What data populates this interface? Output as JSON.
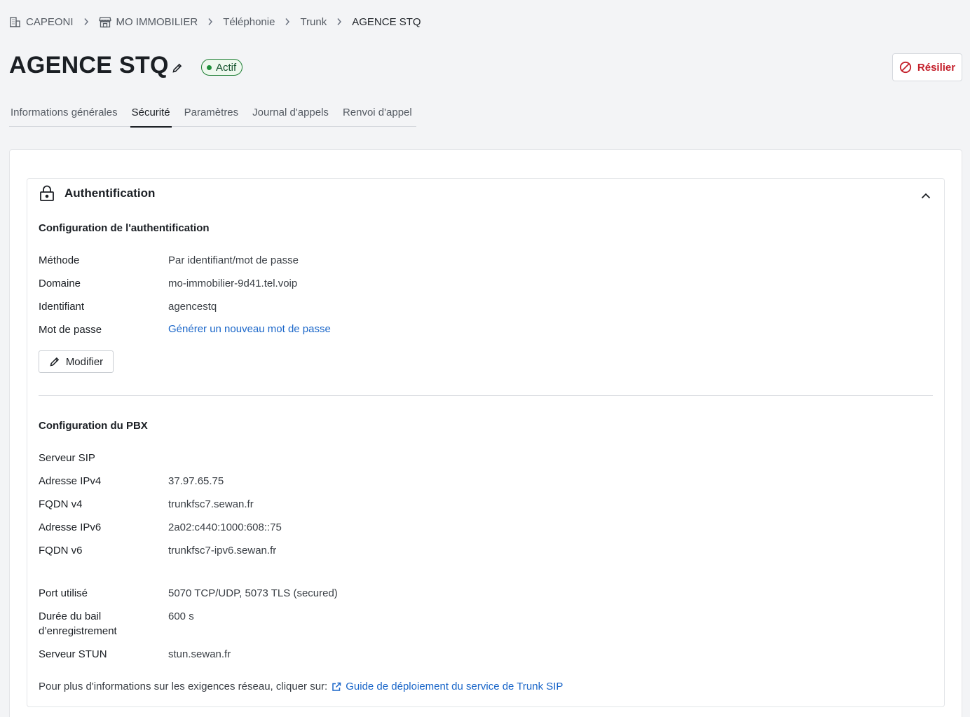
{
  "breadcrumb": {
    "items": [
      {
        "label": "CAPEONI",
        "icon": "building-icon"
      },
      {
        "label": "MO IMMOBILIER",
        "icon": "store-icon"
      },
      {
        "label": "Téléphonie"
      },
      {
        "label": "Trunk"
      },
      {
        "label": "AGENCE STQ"
      }
    ]
  },
  "header": {
    "title": "AGENCE STQ",
    "status": "Actif",
    "terminate_label": "Résilier"
  },
  "tabs": [
    {
      "label": "Informations générales",
      "active": false
    },
    {
      "label": "Sécurité",
      "active": true
    },
    {
      "label": "Paramètres",
      "active": false
    },
    {
      "label": "Journal d'appels",
      "active": false
    },
    {
      "label": "Renvoi d'appel",
      "active": false
    }
  ],
  "auth_section": {
    "title": "Authentification",
    "config_title": "Configuration de l'authentification",
    "rows": [
      {
        "label": "Méthode",
        "value": "Par identifiant/mot de passe"
      },
      {
        "label": "Domaine",
        "value": "mo-immobilier-9d41.tel.voip"
      },
      {
        "label": "Identifiant",
        "value": "agencestq"
      },
      {
        "label": "Mot de passe",
        "value": "Générer un nouveau mot de passe"
      }
    ],
    "modify_label": "Modifier"
  },
  "pbx_section": {
    "title": "Configuration du PBX",
    "sip_server_title": "Serveur SIP",
    "sip_rows": [
      {
        "label": "Adresse IPv4",
        "value": "37.97.65.75"
      },
      {
        "label": "FQDN v4",
        "value": "trunkfsc7.sewan.fr"
      },
      {
        "label": "Adresse IPv6",
        "value": "2a02:c440:1000:608::75"
      },
      {
        "label": "FQDN v6",
        "value": "trunkfsc7-ipv6.sewan.fr"
      }
    ],
    "port_label": "Port utilisé",
    "port_value": "5070 TCP/UDP, 5073 TLS (secured)",
    "lease_label_1": "Durée du bail",
    "lease_label_2": "d’enregistrement",
    "lease_value": "600 s",
    "stun_label": "Serveur STUN",
    "stun_value": "stun.sewan.fr",
    "info_text": "Pour plus d'informations sur les exigences réseau, cliquer sur:",
    "guide_link": "Guide de déploiement du service de Trunk SIP"
  },
  "colors": {
    "accent_link": "#1a66c9",
    "status_green": "#1f8f3a",
    "danger_red": "#c4202b"
  }
}
